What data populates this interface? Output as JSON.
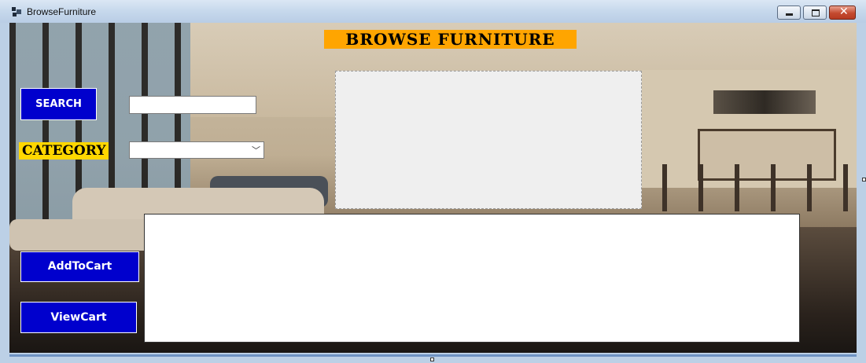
{
  "window": {
    "title": "BrowseFurniture",
    "controls": {
      "minimize": "minimize-icon",
      "maximize": "maximize-icon",
      "close": "close-icon"
    }
  },
  "header": {
    "title": "BROWSE FURNITURE"
  },
  "search": {
    "button_label": "SEARCH",
    "value": "",
    "placeholder": ""
  },
  "category": {
    "label": "CATEGORY",
    "selected": ""
  },
  "actions": {
    "add_to_cart": "AddToCart",
    "view_cart": "ViewCart"
  },
  "colors": {
    "button_bg": "#0000cd",
    "title_banner_bg": "#ffa500",
    "category_label_bg": "#ffd700",
    "close_button": "#c44a2f"
  }
}
